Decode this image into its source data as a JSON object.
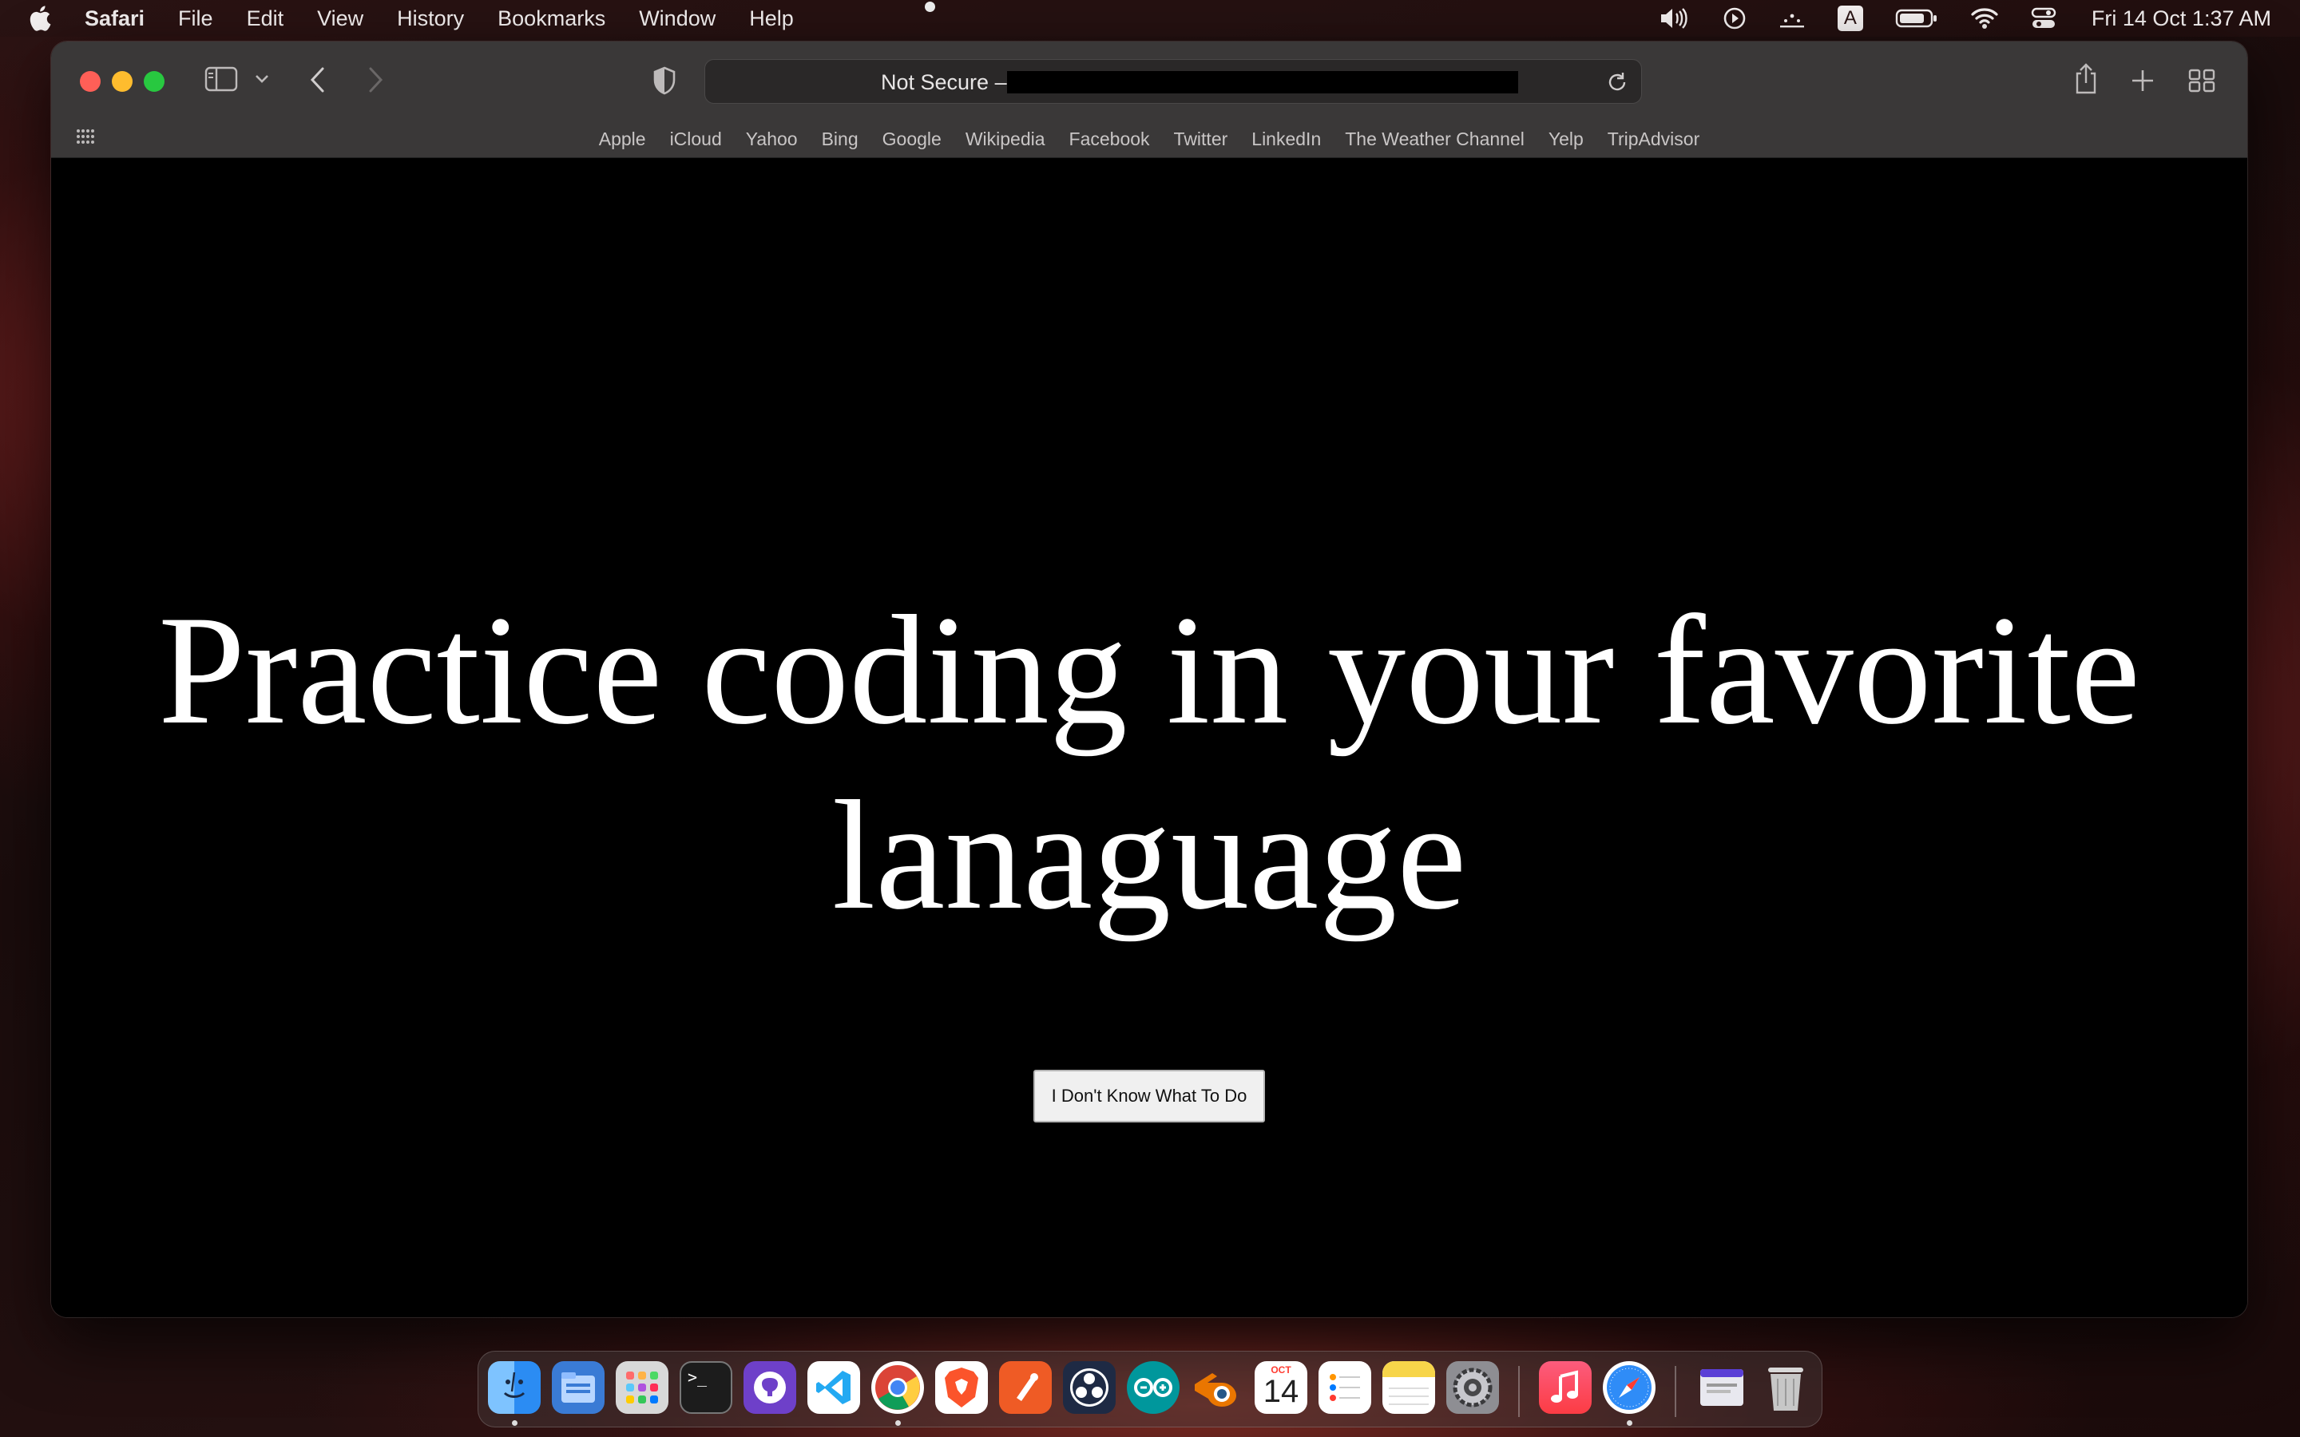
{
  "menubar": {
    "app_name": "Safari",
    "menus": [
      "File",
      "Edit",
      "View",
      "History",
      "Bookmarks",
      "Window",
      "Help"
    ],
    "input_source": "A",
    "clock": "Fri 14 Oct  1:37 AM"
  },
  "browser": {
    "address_text": "Not Secure –",
    "favorites": [
      "Apple",
      "iCloud",
      "Yahoo",
      "Bing",
      "Google",
      "Wikipedia",
      "Facebook",
      "Twitter",
      "LinkedIn",
      "The Weather Channel",
      "Yelp",
      "TripAdvisor"
    ]
  },
  "page": {
    "headline_line1": "Practice coding in your favorite",
    "headline_line2": "lanaguage",
    "button_label": "I Don't Know What To Do"
  },
  "dock": {
    "apps": [
      {
        "name": "finder-icon",
        "color": "#2b8cf3"
      },
      {
        "name": "files-icon",
        "color": "#3a7bd5"
      },
      {
        "name": "launchpad-icon",
        "color": "#cfcfcf"
      },
      {
        "name": "terminal-icon",
        "color": "#1c1c1c"
      },
      {
        "name": "github-desktop-icon",
        "color": "#6e40c9"
      },
      {
        "name": "vscode-icon",
        "color": "#ffffff"
      },
      {
        "name": "chrome-icon",
        "color": "#ffffff"
      },
      {
        "name": "brave-icon",
        "color": "#fb542b"
      },
      {
        "name": "postman-icon",
        "color": "#ef5b25"
      },
      {
        "name": "obs-icon",
        "color": "#1e2a44"
      },
      {
        "name": "arduino-icon",
        "color": "#00979c"
      },
      {
        "name": "blender-icon",
        "color": "#ffffff"
      },
      {
        "name": "calendar-icon",
        "color": "#ffffff"
      },
      {
        "name": "reminders-icon",
        "color": "#ffffff"
      },
      {
        "name": "notes-icon",
        "color": "#f7d54a"
      },
      {
        "name": "system-preferences-icon",
        "color": "#8e8e93"
      },
      {
        "name": "music-icon",
        "color": "#fc3c44"
      },
      {
        "name": "safari-icon",
        "color": "#2f8cf7"
      },
      {
        "name": "downloads-stack-icon",
        "color": "#e8e8ef"
      },
      {
        "name": "trash-icon",
        "color": "#c7c7c7"
      }
    ],
    "calendar_month": "OCT",
    "calendar_day": "14"
  }
}
